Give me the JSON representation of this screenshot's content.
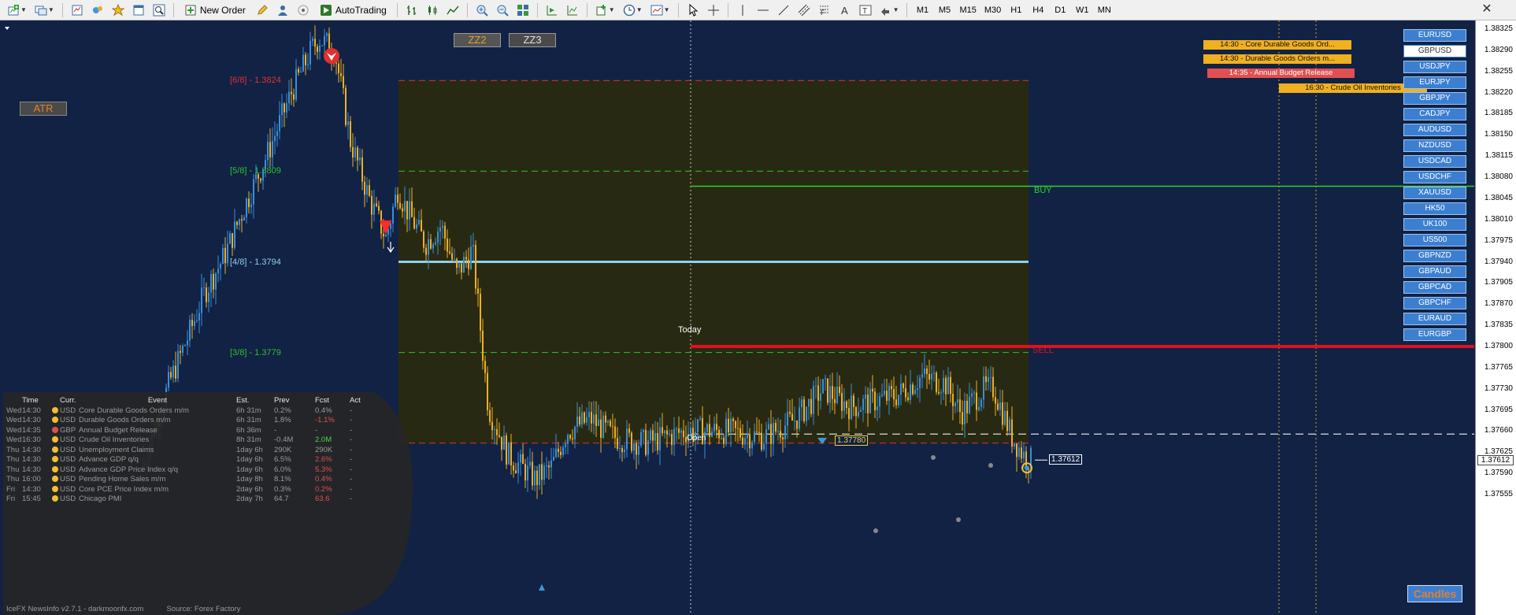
{
  "toolbar": {
    "new_order": "New Order",
    "autotrading": "AutoTrading",
    "timeframes": [
      "M1",
      "M5",
      "M15",
      "M30",
      "H1",
      "H4",
      "D1",
      "W1",
      "MN"
    ]
  },
  "chart": {
    "zz_buttons": [
      "ZZ2",
      "ZZ3"
    ],
    "atr_label": "ATR",
    "murrey_levels": [
      {
        "label": "[6/8] - 1.3824",
        "price": 1.3824,
        "color": "#e03030",
        "style": "dashed"
      },
      {
        "label": "[5/8] - 1.3809",
        "price": 1.3809,
        "color": "#30c030",
        "style": "dashed"
      },
      {
        "label": "[4/8] - 1.3794",
        "price": 1.3794,
        "color": "#8fd0f0",
        "style": "solid"
      },
      {
        "label": "[3/8] - 1.3779",
        "price": 1.3779,
        "color": "#30c030",
        "style": "dashed"
      },
      {
        "label": "",
        "price": 1.3764,
        "color": "#e03030",
        "style": "dashed"
      }
    ],
    "buy_label": "BUY",
    "buy_price": 1.38065,
    "sell_label": "SELL",
    "sell_price": 1.378,
    "today_label": "Today",
    "open_label": "Open",
    "open_price": 1.37655,
    "high_marker": "1.37780",
    "current_marker": "1.37612",
    "current_price": 1.37612,
    "candles_button": "Candles"
  },
  "price_axis": {
    "ticks": [
      "1.38325",
      "1.38290",
      "1.38255",
      "1.38220",
      "1.38185",
      "1.38150",
      "1.38115",
      "1.38080",
      "1.38045",
      "1.38010",
      "1.37975",
      "1.37940",
      "1.37905",
      "1.37870",
      "1.37835",
      "1.37800",
      "1.37765",
      "1.37730",
      "1.37695",
      "1.37660",
      "1.37625",
      "1.37590",
      "1.37555"
    ],
    "current": "1.37612"
  },
  "symbols": [
    "EURUSD",
    "GBPUSD",
    "USDJPY",
    "EURJPY",
    "GBPJPY",
    "CADJPY",
    "AUDUSD",
    "NZDUSD",
    "USDCAD",
    "USDCHF",
    "XAUUSD",
    "HK50",
    "UK100",
    "US500",
    "GBPNZD",
    "GBPAUD",
    "GBPCAD",
    "GBPCHF",
    "EURAUD",
    "EURGBP"
  ],
  "selected_symbol": "GBPUSD",
  "news_tags": [
    {
      "text": "14:30 - Core Durable Goods Ord...",
      "cur": "usd"
    },
    {
      "text": "14:30 - Durable Goods Orders m...",
      "cur": "usd"
    },
    {
      "text": "14:35 - Annual Budget Release",
      "cur": "gbp"
    },
    {
      "text": "16:30 - Crude Oil Inventories",
      "cur": "usd"
    }
  ],
  "news": {
    "headers": {
      "time": "Time",
      "curr": "Curr.",
      "event": "Event",
      "est": "Est.",
      "prev": "Prev",
      "fcst": "Fcst",
      "act": "Act"
    },
    "rows": [
      {
        "day": "Wed",
        "time": "14:30",
        "cur": "USD",
        "event": "Core Durable Goods Orders m/m",
        "est": "6h 31m",
        "prev": "0.2%",
        "fcst": "0.4%",
        "fcst_color": "",
        "act": "-"
      },
      {
        "day": "Wed",
        "time": "14:30",
        "cur": "USD",
        "event": "Durable Goods Orders m/m",
        "est": "6h 31m",
        "prev": "1.8%",
        "fcst": "-1.1%",
        "fcst_color": "red",
        "act": "-"
      },
      {
        "day": "Wed",
        "time": "14:35",
        "cur": "GBP",
        "event": "Annual Budget Release",
        "est": "6h 36m",
        "prev": "-",
        "fcst": "-",
        "fcst_color": "",
        "act": "-"
      },
      {
        "day": "Wed",
        "time": "16:30",
        "cur": "USD",
        "event": "Crude Oil Inventories",
        "est": "8h 31m",
        "prev": "-0.4M",
        "fcst": "2.0M",
        "fcst_color": "green",
        "act": "-"
      },
      {
        "day": "Thu",
        "time": "14:30",
        "cur": "USD",
        "event": "Unemployment Claims",
        "est": "1day 6h",
        "prev": "290K",
        "fcst": "290K",
        "fcst_color": "",
        "act": "-"
      },
      {
        "day": "Thu",
        "time": "14:30",
        "cur": "USD",
        "event": "Advance GDP q/q",
        "est": "1day 6h",
        "prev": "6.5%",
        "fcst": "2.6%",
        "fcst_color": "red",
        "act": "-"
      },
      {
        "day": "Thu",
        "time": "14:30",
        "cur": "USD",
        "event": "Advance GDP Price Index q/q",
        "est": "1day 6h",
        "prev": "6.0%",
        "fcst": "5.3%",
        "fcst_color": "red",
        "act": "-"
      },
      {
        "day": "Thu",
        "time": "16:00",
        "cur": "USD",
        "event": "Pending Home Sales m/m",
        "est": "1day 8h",
        "prev": "8.1%",
        "fcst": "0.4%",
        "fcst_color": "red",
        "act": "-"
      },
      {
        "day": "Fri",
        "time": "14:30",
        "cur": "USD",
        "event": "Core PCE Price Index m/m",
        "est": "2day 6h",
        "prev": "0.3%",
        "fcst": "0.2%",
        "fcst_color": "red",
        "act": "-"
      },
      {
        "day": "Fri",
        "time": "15:45",
        "cur": "USD",
        "event": "Chicago PMI",
        "est": "2day 7h",
        "prev": "64.7",
        "fcst": "63.6",
        "fcst_color": "red",
        "act": "-"
      }
    ],
    "footer_left": "IceFX NewsInfo v2.7.1  -  darkmoonfx.com",
    "footer_right": "Source: Forex Factory"
  },
  "colors": {
    "chart_bg": "#112244",
    "bull": "#3a8fd8",
    "bear": "#f0b020",
    "zone": "#2a2a10"
  }
}
